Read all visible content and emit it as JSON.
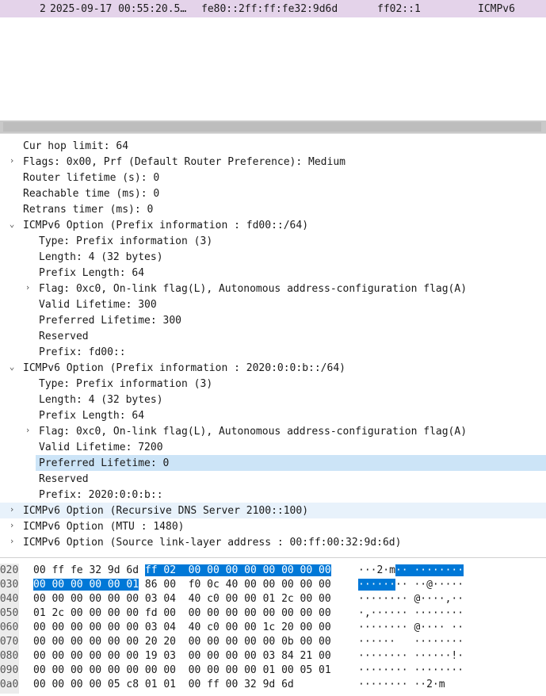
{
  "packet_list": {
    "row": {
      "no": "2",
      "time": "2025-09-17 00:55:20.5…",
      "source": "fe80::2ff:ff:fe32:9d6d",
      "destination": "ff02::1",
      "protocol": "ICMPv6"
    }
  },
  "tree": [
    {
      "text": "Cur hop limit: 64"
    },
    {
      "text": "Flags: 0x00, Prf (Default Router Preference): Medium",
      "arrow": "›"
    },
    {
      "text": "Router lifetime (s): 0"
    },
    {
      "text": "Reachable time (ms): 0"
    },
    {
      "text": "Retrans timer (ms): 0"
    },
    {
      "text": "ICMPv6 Option (Prefix information : fd00::/64)",
      "arrow": "⌄"
    },
    {
      "text": "Type: Prefix information (3)"
    },
    {
      "text": "Length: 4 (32 bytes)"
    },
    {
      "text": "Prefix Length: 64"
    },
    {
      "text": "Flag: 0xc0, On-link flag(L), Autonomous address-configuration flag(A)",
      "arrow": "›"
    },
    {
      "text": "Valid Lifetime: 300"
    },
    {
      "text": "Preferred Lifetime: 300"
    },
    {
      "text": "Reserved"
    },
    {
      "text": "Prefix: fd00::"
    },
    {
      "text": "ICMPv6 Option (Prefix information : 2020:0:0:b::/64)",
      "arrow": "⌄"
    },
    {
      "text": "Type: Prefix information (3)"
    },
    {
      "text": "Length: 4 (32 bytes)"
    },
    {
      "text": "Prefix Length: 64"
    },
    {
      "text": "Flag: 0xc0, On-link flag(L), Autonomous address-configuration flag(A)",
      "arrow": "›"
    },
    {
      "text": "Valid Lifetime: 7200"
    },
    {
      "text": "Preferred Lifetime: 0",
      "state": "selected"
    },
    {
      "text": "Reserved"
    },
    {
      "text": "Prefix: 2020:0:0:b::"
    },
    {
      "text": "ICMPv6 Option (Recursive DNS Server 2100::100)",
      "arrow": "›",
      "state": "hover"
    },
    {
      "text": "ICMPv6 Option (MTU : 1480)",
      "arrow": "›"
    },
    {
      "text": "ICMPv6 Option (Source link-layer address : 00:ff:00:32:9d:6d)",
      "arrow": "›"
    }
  ],
  "bytes": [
    {
      "offset": "0020",
      "hex_a": "00 ff fe 32 9d 6d ",
      "hex_hl": "ff 02  00 00 00 00 00 00 00 00",
      "hex_b": "",
      "asc_a": "···2·m",
      "asc_hl": "·· ········",
      "asc_b": ""
    },
    {
      "offset": "0030",
      "hex_a": "",
      "hex_hl": "00 00 00 00 00 01",
      "hex_b": " 86 00  f0 0c 40 00 00 00 00 00",
      "asc_a": "",
      "asc_hl": "······",
      "asc_b": "·· ··@·····"
    },
    {
      "offset": "0040",
      "hex_a": "00 00 00 00 00 00 03 04  40 c0 00 00 01 2c 00 00",
      "asc_a": "········ @····,··"
    },
    {
      "offset": "0050",
      "hex_a": "01 2c 00 00 00 00 fd 00  00 00 00 00 00 00 00 00",
      "asc_a": "·,······ ········"
    },
    {
      "offset": "0060",
      "hex_a": "00 00 00 00 00 00 03 04  40 c0 00 00 1c 20 00 00",
      "asc_a": "········ @···· ··"
    },
    {
      "offset": "0070",
      "hex_a": "00 00 00 00 00 00 20 20  00 00 00 00 00 0b 00 00",
      "asc_a": "······   ········"
    },
    {
      "offset": "0080",
      "hex_a": "00 00 00 00 00 00 19 03  00 00 00 00 03 84 21 00",
      "asc_a": "········ ······!·"
    },
    {
      "offset": "0090",
      "hex_a": "00 00 00 00 00 00 00 00  00 00 00 00 01 00 05 01",
      "asc_a": "········ ········"
    },
    {
      "offset": "00a0",
      "hex_a": "00 00 00 00 05 c8 01 01  00 ff 00 32 9d 6d",
      "asc_a": "········ ··2·m"
    }
  ]
}
